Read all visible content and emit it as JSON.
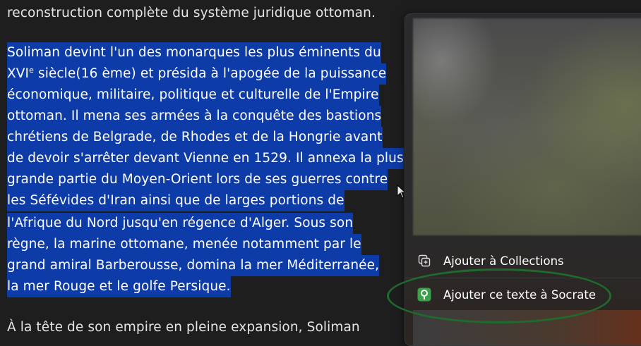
{
  "article": {
    "line_top": "reconstruction complète du système juridique ottoman.",
    "selected": [
      "Soliman devint l'un des monarques les plus éminents du",
      "siècle(16 ème) et présida à l'apogée de la puissance",
      "économique, militaire, politique et culturelle de l'Empire",
      "ottoman. Il mena ses armées à la conquête des bastions",
      "chrétiens de Belgrade, de Rhodes et de la Hongrie avant",
      "de devoir s'arrêter devant Vienne en 1529. Il annexa la plus",
      "grande partie du Moyen-Orient lors de ses guerres contre",
      "les Séfévides d'Iran ainsi que de larges portions de",
      "l'Afrique du Nord jusqu'en régence d'Alger. Sous son",
      "règne, la marine ottomane, menée notamment par le",
      "grand amiral Barberousse, domina la mer Méditerranée,",
      "la mer Rouge et le golfe Persique."
    ],
    "century_roman": "XVI",
    "century_sup": "e",
    "line_bottom": "À la tête de son empire en pleine expansion, Soliman"
  },
  "context_menu": {
    "items": [
      {
        "label": "Ajouter à Collections",
        "icon": "collections-add-icon"
      },
      {
        "label": "Ajouter ce texte à Socrate",
        "icon": "socrate-tree-icon"
      }
    ]
  },
  "colors": {
    "selection": "#0d3ba8",
    "annotation": "#1f6b2e",
    "background": "#1e1e1f"
  }
}
